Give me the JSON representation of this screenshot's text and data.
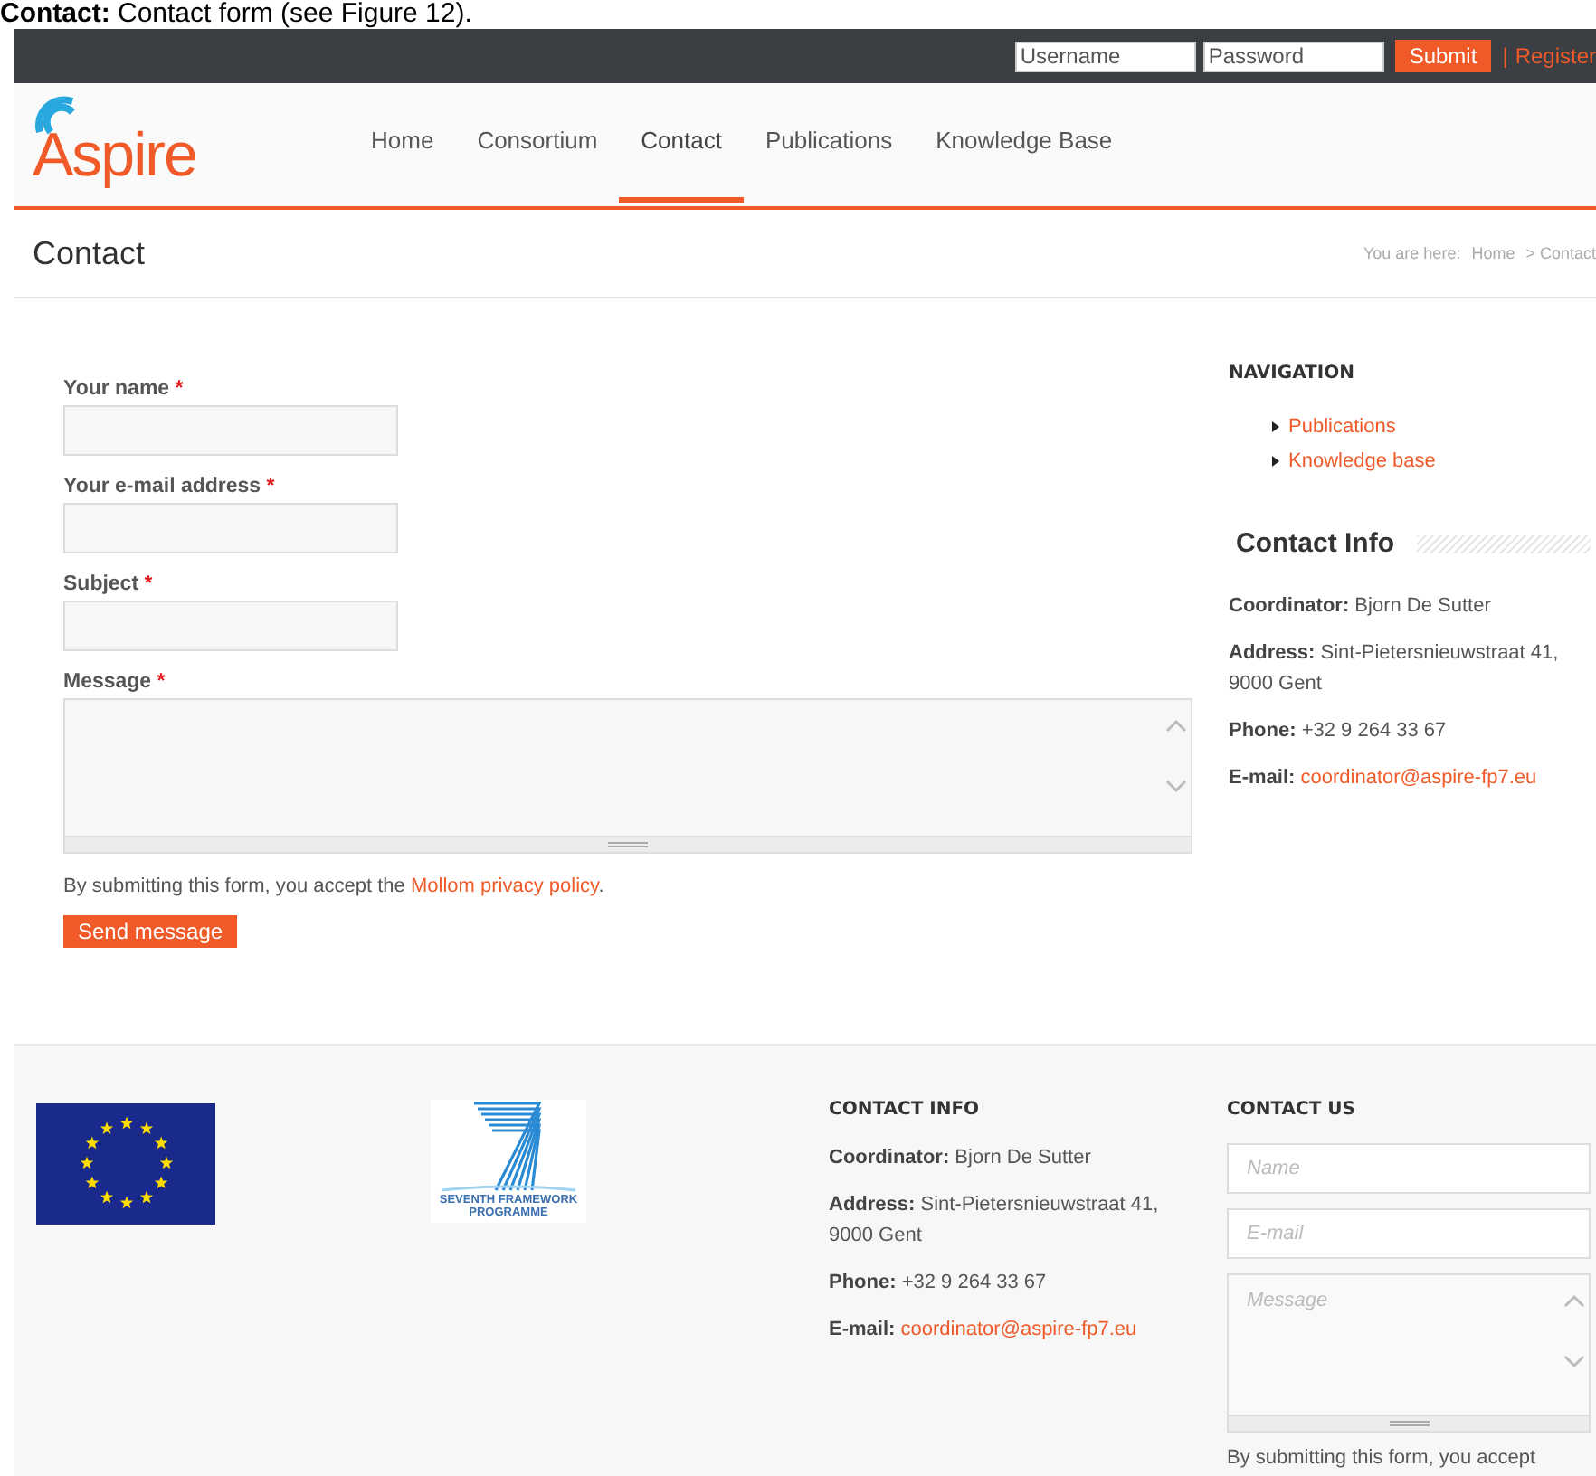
{
  "caption": "**Contact:** Contact form (see Figure 12).",
  "top_bar": {
    "username_placeholder": "Username",
    "password_placeholder": "Password",
    "submit": "Submit",
    "separator": "|",
    "register": "Register"
  },
  "logo": "Aspire",
  "nav": [
    {
      "label": "Home",
      "selected": false
    },
    {
      "label": "Consortium",
      "selected": false
    },
    {
      "label": "Contact",
      "selected": true
    },
    {
      "label": "Publications",
      "selected": false
    },
    {
      "label": "Knowledge Base",
      "selected": false
    }
  ],
  "page_title": "Contact",
  "breadcrumb": {
    "prefix": "You are here:",
    "items": [
      "Home",
      "> Contact"
    ]
  },
  "form": {
    "fields": [
      {
        "label": "Your name",
        "required": "*",
        "kind": "input"
      },
      {
        "label": "Your e-mail address",
        "required": "*",
        "kind": "input"
      },
      {
        "label": "Subject",
        "required": "*",
        "kind": "input"
      },
      {
        "label": "Message",
        "required": "*",
        "kind": "textarea"
      }
    ],
    "notice": "By submitting this form, you accept the ",
    "notice_link": "Mollom privacy policy",
    "notice_end": ".",
    "button": "Send message"
  },
  "sidebar": {
    "nav_heading": "NAVIGATION",
    "nav_links": [
      "Publications",
      "Knowledge base"
    ],
    "contact_heading": "Contact Info",
    "contact": [
      {
        "label": "Coordinator:",
        "value": "Bjorn De Sutter",
        "kind": "text"
      },
      {
        "label": "Address:",
        "value": "Sint-Pietersnieuwstraat 41, 9000 Gent",
        "kind": "text"
      },
      {
        "label": "Phone:",
        "value": "+32 9 264 33 67",
        "kind": "text"
      },
      {
        "label": "E-mail:",
        "value": "coordinator@aspire-fp7.eu",
        "kind": "link"
      }
    ]
  },
  "footer": {
    "fp7_text": [
      "SEVENTH FRAMEWORK",
      "PROGRAMME"
    ],
    "contact_heading": "CONTACT INFO",
    "contact": [
      {
        "label": "Coordinator:",
        "value": "Bjorn De Sutter",
        "kind": "text"
      },
      {
        "label": "Address:",
        "value": "Sint-Pietersnieuwstraat 41, 9000 Gent",
        "kind": "text"
      },
      {
        "label": "Phone:",
        "value": "+32 9 264 33 67",
        "kind": "text"
      },
      {
        "label": "E-mail:",
        "value": "coordinator@aspire-fp7.eu",
        "kind": "link"
      }
    ],
    "form_heading": "CONTACT US",
    "fields": [
      {
        "placeholder": "Name",
        "kind": "input"
      },
      {
        "placeholder": "E-mail",
        "kind": "input"
      },
      {
        "placeholder": "Message",
        "kind": "textarea"
      }
    ],
    "notice": "By submitting this form, you accept"
  }
}
